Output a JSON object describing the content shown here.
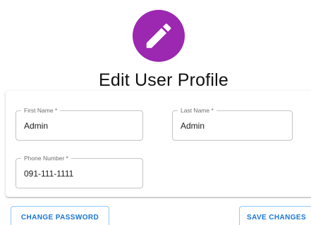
{
  "header": {
    "avatar_icon": "edit-pencil-icon",
    "avatar_color": "#9c27b0",
    "title": "Edit User Profile"
  },
  "form": {
    "first_name": {
      "label": "First Name *",
      "value": "Admin"
    },
    "last_name": {
      "label": "Last Name *",
      "value": "Admin"
    },
    "phone": {
      "label": "Phone Number *",
      "value": "091-111-1111"
    }
  },
  "actions": {
    "change_password_label": "CHANGE PASSWORD",
    "save_changes_label": "SAVE CHANGES",
    "accent_color": "#1976d2"
  }
}
